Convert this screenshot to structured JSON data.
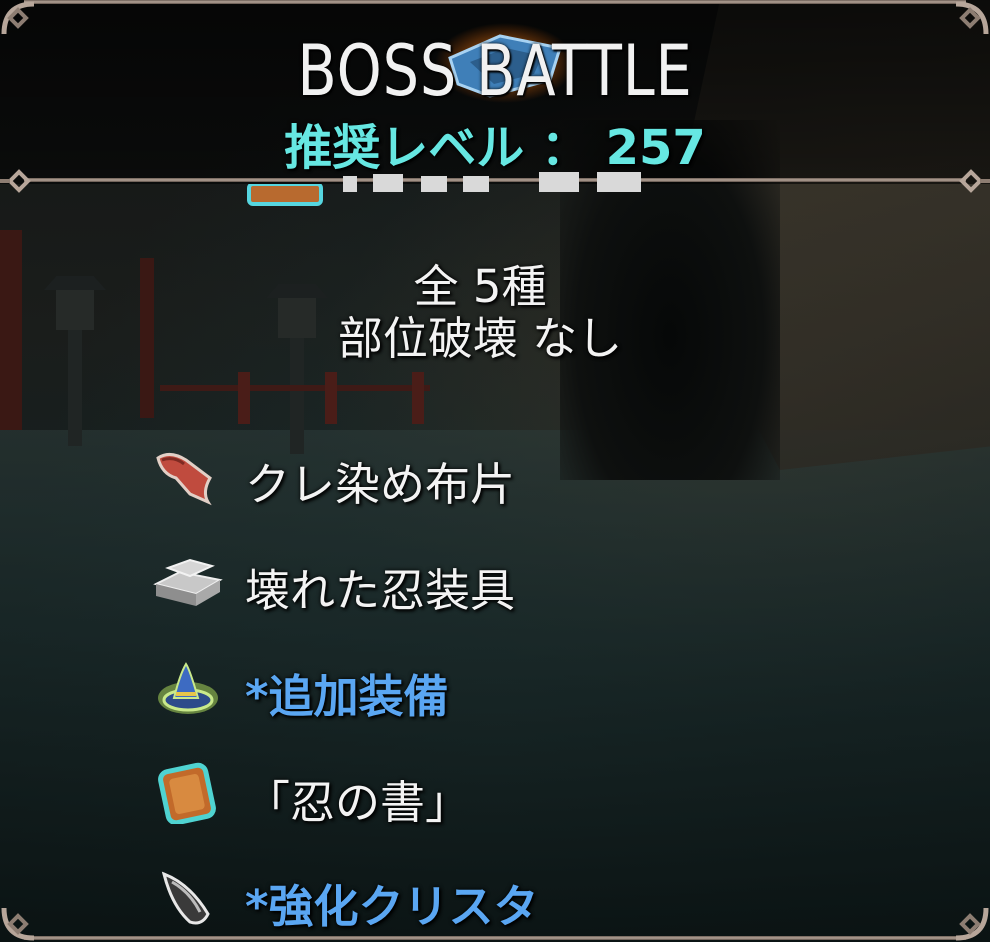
{
  "header": {
    "title": "BOSS BATTLE",
    "level_label": "推奨レベル ： 257"
  },
  "drops": {
    "count_label": "全 5種",
    "part_break_label": "部位破壊 なし",
    "items": [
      {
        "name": "クレ染め布片",
        "icon": "cloth-icon",
        "highlight": false
      },
      {
        "name": "壊れた忍装具",
        "icon": "metal-ingot-icon",
        "highlight": false
      },
      {
        "name": "*追加装備",
        "icon": "wizard-hat-icon",
        "highlight": true
      },
      {
        "name": "「忍の書」",
        "icon": "book-icon",
        "highlight": false
      },
      {
        "name": "*強化クリスタ",
        "icon": "crystal-icon",
        "highlight": true
      }
    ]
  },
  "colors": {
    "level_text": "#66e7e2",
    "highlight_text": "#5aa6f2",
    "normal_text": "#f3f3f3",
    "frame": "#b7a69a"
  }
}
